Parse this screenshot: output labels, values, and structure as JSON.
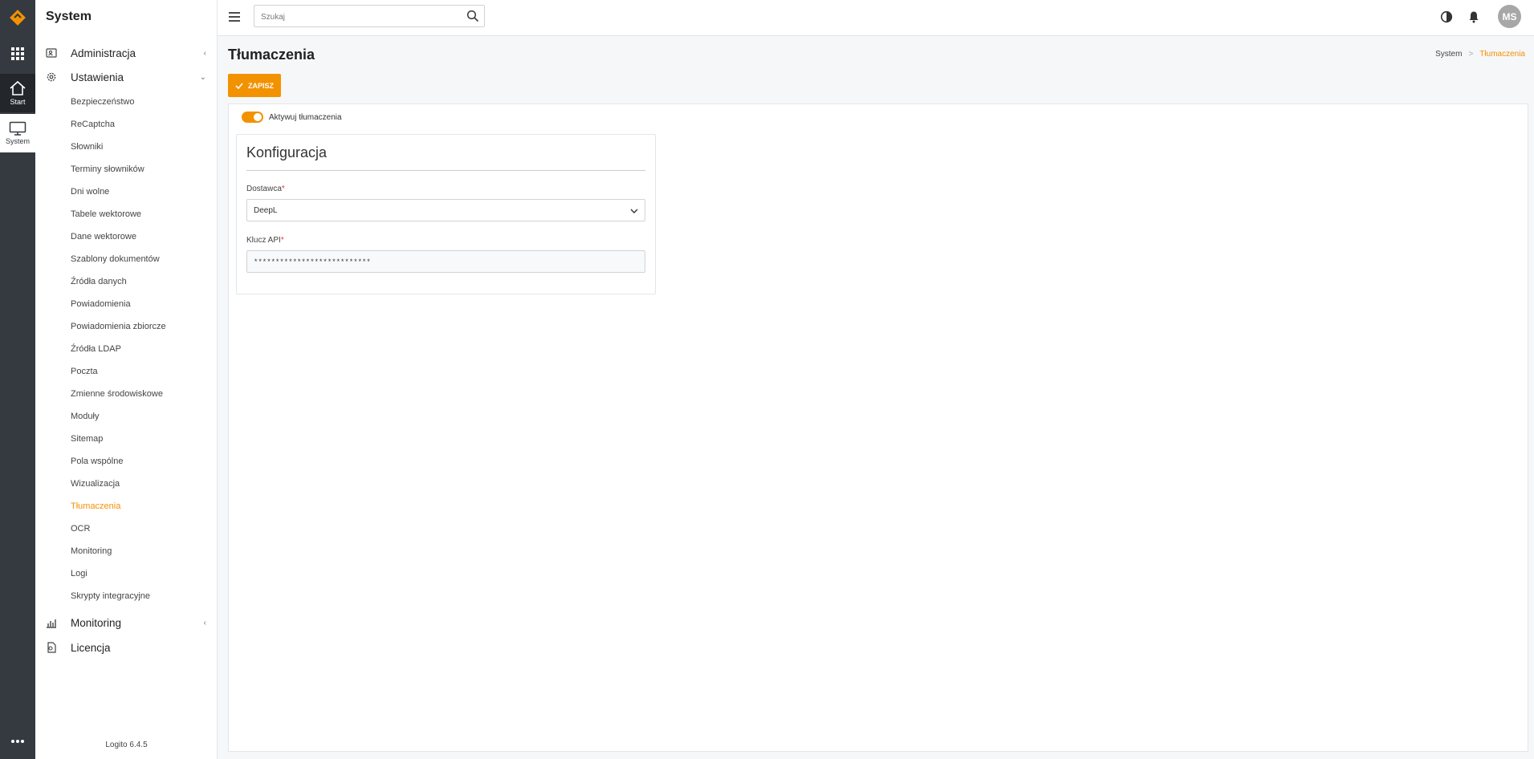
{
  "rail": {
    "start_label": "Start",
    "system_label": "System"
  },
  "sidebar": {
    "title": "System",
    "groups": {
      "administracja": "Administracja",
      "ustawienia": "Ustawienia",
      "monitoring": "Monitoring",
      "licencja": "Licencja"
    },
    "items": [
      "Bezpieczeństwo",
      "ReCaptcha",
      "Słowniki",
      "Terminy słowników",
      "Dni wolne",
      "Tabele wektorowe",
      "Dane wektorowe",
      "Szablony dokumentów",
      "Źródła danych",
      "Powiadomienia",
      "Powiadomienia zbiorcze",
      "Źródła LDAP",
      "Poczta",
      "Zmienne środowiskowe",
      "Moduły",
      "Sitemap",
      "Pola wspólne",
      "Wizualizacja",
      "Tłumaczenia",
      "OCR",
      "Monitoring",
      "Logi",
      "Skrypty integracyjne"
    ],
    "active_item": "Tłumaczenia",
    "footer": "Logito 6.4.5"
  },
  "topbar": {
    "search_placeholder": "Szukaj",
    "avatar_initials": "MS"
  },
  "page": {
    "title": "Tłumaczenia",
    "breadcrumb": {
      "home": "System",
      "separator": ">",
      "current": "Tłumaczenia"
    },
    "save_label": "ZAPISZ",
    "toggle_label": "Aktywuj tłumaczenia",
    "toggle_on": true
  },
  "config": {
    "title": "Konfiguracja",
    "provider_label": "Dostawca",
    "provider_value": "DeepL",
    "api_key_label": "Klucz API",
    "api_key_value": "***************************",
    "required_mark": "*"
  },
  "colors": {
    "accent": "#f39200",
    "rail": "#343a40",
    "required": "#e53935"
  }
}
